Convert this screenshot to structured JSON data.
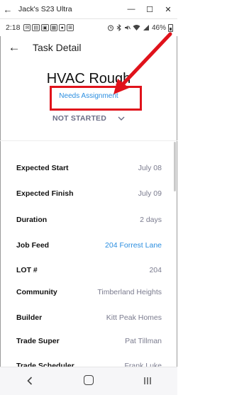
{
  "window": {
    "title": "Jack's S23 Ultra",
    "back_glyph": "←",
    "minimize_glyph": "—",
    "maximize_glyph": "☐",
    "close_glyph": "✕"
  },
  "status_bar": {
    "time": "2:18",
    "notification_icons": [
      "✉",
      "▤",
      "▣",
      "▦",
      "●",
      "⊞"
    ],
    "battery_text": "46%"
  },
  "app_bar": {
    "back_glyph": "←",
    "title": "Task Detail"
  },
  "task": {
    "title": "HVAC Rough",
    "assignment_link": "Needs Assignment",
    "status": "NOT STARTED"
  },
  "details": [
    {
      "label": "Expected Start",
      "value": "July 08",
      "is_link": false
    },
    {
      "label": "Expected Finish",
      "value": "July 09",
      "is_link": false
    },
    {
      "label": "Duration",
      "value": "2 days",
      "is_link": false
    },
    {
      "label": "Job Feed",
      "value": "204 Forrest Lane",
      "is_link": true
    },
    {
      "label": "LOT #",
      "value": "204",
      "is_link": false
    },
    {
      "label": "Community",
      "value": "Timberland Heights",
      "is_link": false
    },
    {
      "label": "Builder",
      "value": "Kitt Peak Homes",
      "is_link": false
    },
    {
      "label": "Trade Super",
      "value": "Pat Tillman",
      "is_link": false
    },
    {
      "label": "Trade Scheduler",
      "value": "Frank Luke",
      "is_link": false
    }
  ],
  "colors": {
    "link_blue": "#2b8ee0",
    "annotation_red": "#e0121b",
    "status_gray": "#6b6e86"
  }
}
